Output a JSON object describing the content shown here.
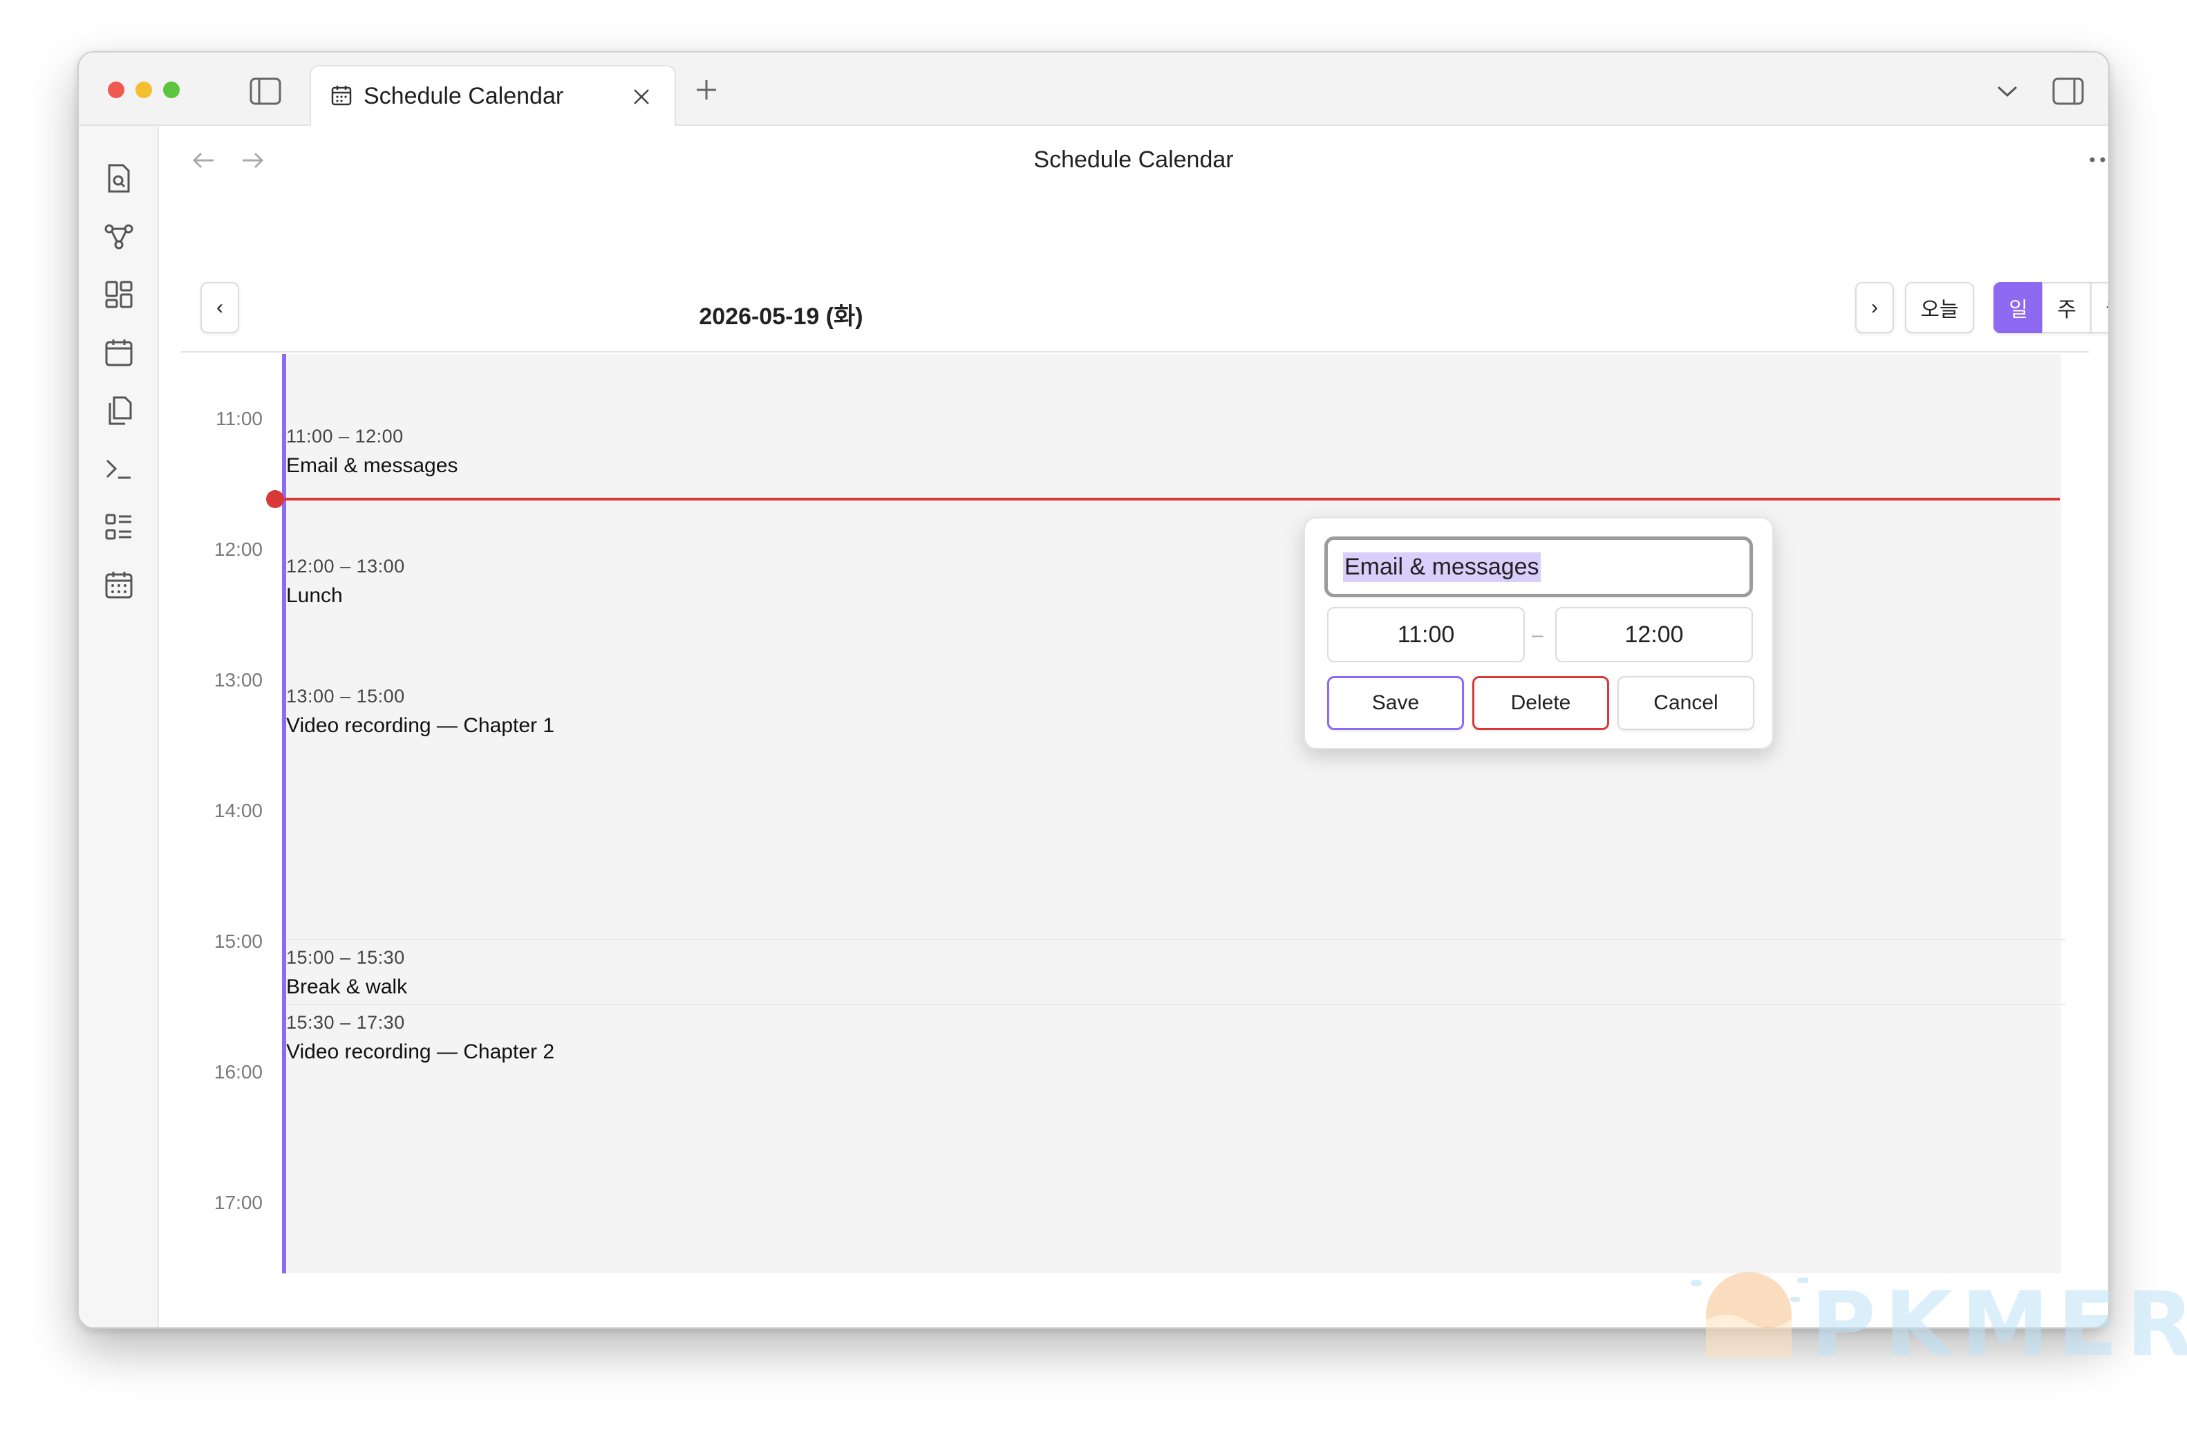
{
  "titlebar": {
    "tab_title": "Schedule Calendar"
  },
  "view": {
    "title": "Schedule Calendar"
  },
  "calendar": {
    "date": "2026-05-19 (화)",
    "prev_label": "‹",
    "next_label": "›",
    "today_label": "오늘",
    "view_modes": [
      {
        "label": "일",
        "active": true
      },
      {
        "label": "주",
        "active": false
      },
      {
        "label": "월",
        "active": false
      }
    ],
    "hours": [
      "11:00",
      "12:00",
      "13:00",
      "14:00",
      "15:00",
      "16:00",
      "17:00"
    ],
    "events": [
      {
        "time": "11:00 – 12:00",
        "title": "Email & messages"
      },
      {
        "time": "12:00 – 13:00",
        "title": "Lunch"
      },
      {
        "time": "13:00 – 15:00",
        "title": "Video recording — Chapter 1"
      },
      {
        "time": "15:00 – 15:30",
        "title": "Break & walk"
      },
      {
        "time": "15:30 – 17:30",
        "title": "Video recording — Chapter 2"
      }
    ],
    "accent_color": "#8e6af3",
    "now_line_color": "#d83838"
  },
  "editor": {
    "title_value": "Email & messages",
    "start_time": "11:00",
    "end_time": "12:00",
    "separator": "–",
    "save_label": "Save",
    "delete_label": "Delete",
    "cancel_label": "Cancel"
  },
  "watermark": {
    "text": "PKMER"
  }
}
